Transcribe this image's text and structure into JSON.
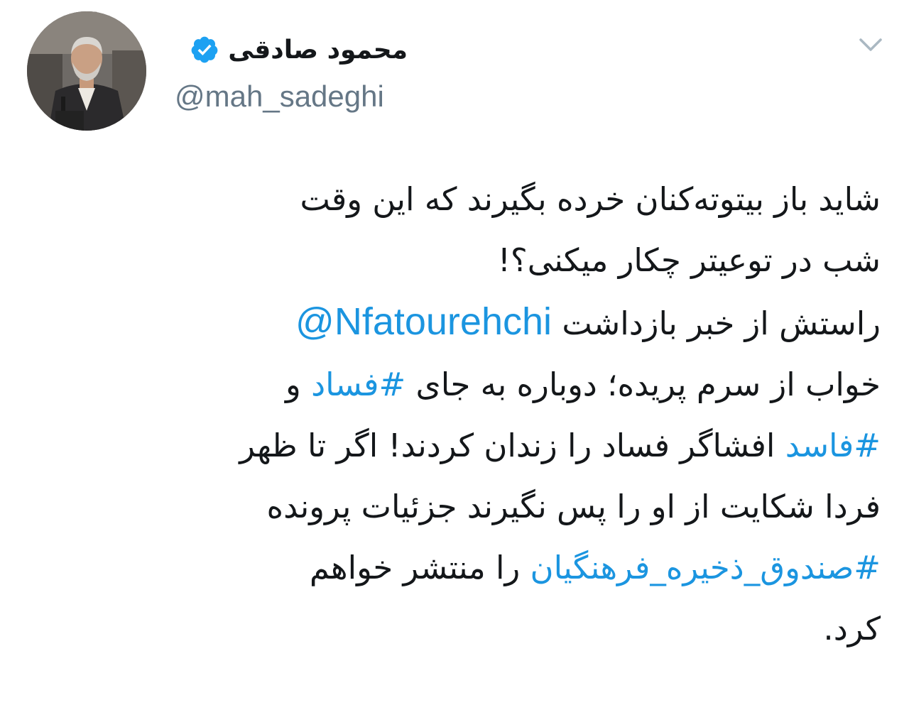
{
  "author": {
    "display_name": "محمود صادقی",
    "handle": "@mah_sadeghi",
    "verified": true,
    "verified_color": "#1da1f2",
    "avatar_icon": "profile-photo"
  },
  "menu": {
    "icon": "chevron-down-icon"
  },
  "tweet": {
    "line1": "شاید باز بیتوته‌کنان خرده بگیرند که این وقت",
    "line2": "شب در توعیتر چکار میکنی؟!",
    "line3_text": "راستش از خبر بازداشت",
    "mention": "@Nfatourehchi",
    "line4_text": "خواب از سرم پریده؛ دوباره به جای",
    "hashtag1": "#فساد",
    "line4_tail": "و",
    "hashtag2": "#فاسد",
    "line5_text": "افشاگر فساد را زندان کردند! اگر تا ظهر",
    "line6": "فردا شکایت از او را پس نگیرند جزئیات پرونده",
    "hashtag3": "#صندوق_ذخیره_فرهنگیان",
    "line7_text": "را منتشر خواهم",
    "line8": "کرد."
  },
  "colors": {
    "link": "#1b95e0",
    "text": "#14171a",
    "secondary": "#657786"
  }
}
